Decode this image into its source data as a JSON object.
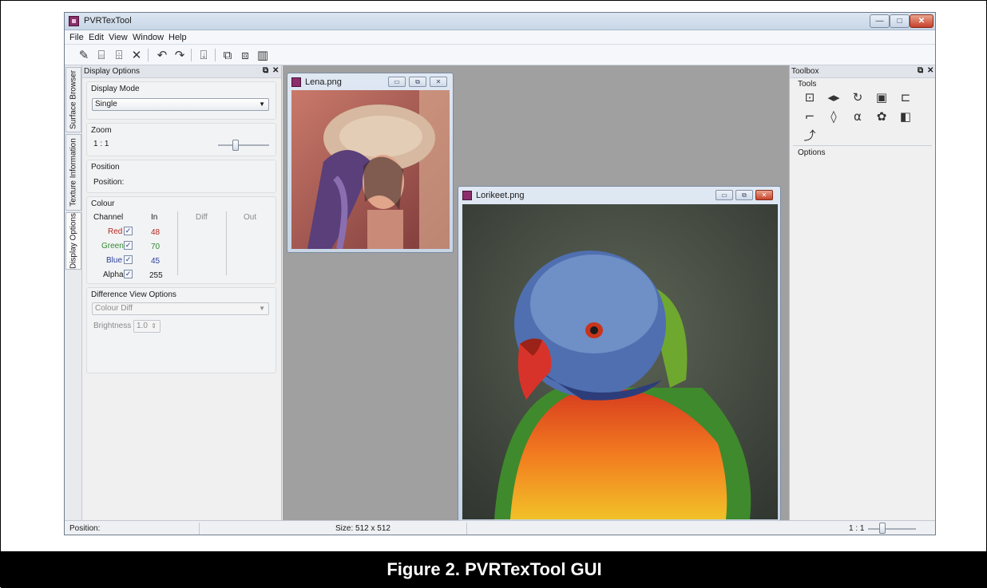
{
  "window": {
    "title": "PVRTexTool"
  },
  "menu": [
    "File",
    "Edit",
    "View",
    "Window",
    "Help"
  ],
  "toolbar_icons": [
    "new-file-icon",
    "open-file-icon",
    "open-folder-icon",
    "close-icon",
    "undo-icon",
    "redo-icon",
    "encode-icon",
    "compress-icon",
    "decompress-icon",
    "histogram-icon"
  ],
  "side_tabs": [
    "Surface Browser",
    "Texture Information",
    "Display Options"
  ],
  "display_options": {
    "panel_title": "Display Options",
    "display_mode": {
      "label": "Display Mode",
      "value": "Single"
    },
    "zoom": {
      "label": "Zoom",
      "value": "1 : 1"
    },
    "position": {
      "label": "Position",
      "field": "Position:"
    },
    "colour": {
      "label": "Colour",
      "headers": [
        "Channel",
        "In",
        "Diff",
        "Out"
      ],
      "channels": [
        {
          "name": "Red",
          "in": "48",
          "color": "#b3261e"
        },
        {
          "name": "Green",
          "in": "70",
          "color": "#2f8a2f"
        },
        {
          "name": "Blue",
          "in": "45",
          "color": "#2b3f9a"
        },
        {
          "name": "Alpha",
          "in": "255",
          "color": "#222222"
        }
      ]
    },
    "difference": {
      "label": "Difference View Options",
      "mode": "Colour Diff",
      "brightness_label": "Brightness x",
      "brightness_value": "1.0"
    }
  },
  "documents": [
    {
      "title": "Lena.png"
    },
    {
      "title": "Lorikeet.png"
    }
  ],
  "toolbox": {
    "title": "Toolbox",
    "tools_label": "Tools",
    "options_label": "Options",
    "tools": [
      "resize-icon",
      "flip-icon",
      "rotate-icon",
      "border-icon",
      "mipmap-icon",
      "crop-icon",
      "alpha-drop-icon",
      "alpha-symbol-icon",
      "palette-icon",
      "channel-copy-icon",
      "normal-map-icon"
    ]
  },
  "status": {
    "position": "Position:",
    "size": "Size: 512 x 512",
    "zoom": "1 : 1"
  },
  "caption": "Figure 2. PVRTexTool GUI"
}
